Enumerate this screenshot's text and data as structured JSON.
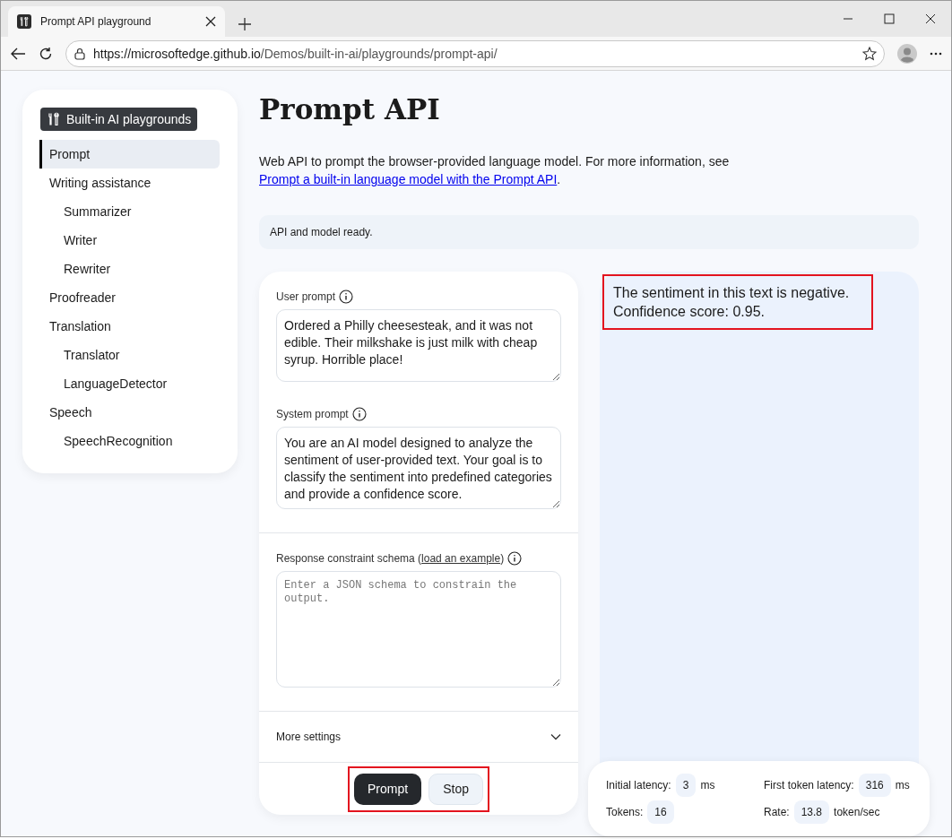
{
  "browser": {
    "tab_title": "Prompt API playground",
    "url_host": "https://microsoftedge.github.io",
    "url_path": "/Demos/built-in-ai/playgrounds/prompt-api/"
  },
  "sidebar": {
    "badge": "Built-in AI playgrounds",
    "items": [
      {
        "label": "Prompt",
        "selected": true
      },
      {
        "label": "Writing assistance",
        "selected": false,
        "children": [
          {
            "label": "Summarizer",
            "selected": false
          },
          {
            "label": "Writer",
            "selected": false
          },
          {
            "label": "Rewriter",
            "selected": false
          }
        ]
      },
      {
        "label": "Proofreader",
        "selected": false
      },
      {
        "label": "Translation",
        "selected": false,
        "children": [
          {
            "label": "Translator",
            "selected": false
          },
          {
            "label": "LanguageDetector",
            "selected": false
          }
        ]
      },
      {
        "label": "Speech",
        "selected": false,
        "children": [
          {
            "label": "SpeechRecognition",
            "selected": false
          }
        ]
      }
    ]
  },
  "title": "Prompt API",
  "description": {
    "text": "Web API to prompt the browser-provided language model. For more information, see ",
    "link": "Prompt a built-in language model with the Prompt API",
    "after": "."
  },
  "status": "API and model ready.",
  "form": {
    "user_prompt": {
      "label": "User prompt",
      "value": "Ordered a Philly cheesesteak, and it was not edible. Their milkshake is just milk with cheap syrup. Horrible place!"
    },
    "system_prompt": {
      "label": "System prompt",
      "value": "You are an AI model designed to analyze the sentiment of user-provided text. Your goal is to classify the sentiment into predefined categories and provide a confidence score."
    },
    "schema": {
      "label": "Response constraint schema (",
      "link": "load an example",
      "after": ")",
      "placeholder": "Enter a JSON schema to constrain the output."
    },
    "more_settings": {
      "label": "More settings",
      "expanded": false
    }
  },
  "actions": {
    "highlighted": true,
    "buttons": [
      {
        "label": "Prompt",
        "kind": "primary"
      },
      {
        "label": "Stop",
        "kind": "secondary"
      }
    ]
  },
  "output": {
    "highlighted": true,
    "lines": [
      "The sentiment in this text is negative.",
      "Confidence score: 0.95."
    ]
  },
  "stats": [
    {
      "label": "Initial latency:",
      "value": "3",
      "unit": "ms"
    },
    {
      "label": "First token latency:",
      "value": "316",
      "unit": "ms"
    },
    {
      "label": "Tokens:",
      "value": "16"
    },
    {
      "label": "Rate:",
      "value": "13.8",
      "unit": "token/sec"
    }
  ]
}
